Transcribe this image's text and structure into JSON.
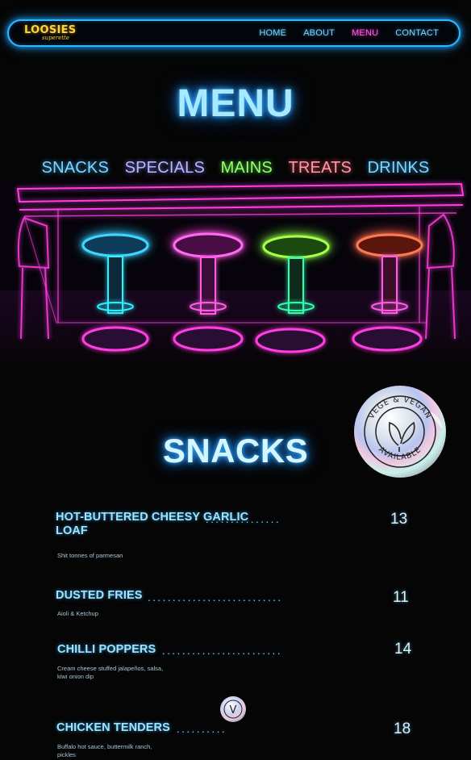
{
  "nav": {
    "logo_main": "LOOSIES",
    "logo_sub": "superette",
    "links": [
      "HOME",
      "ABOUT",
      "MENU",
      "CONTACT"
    ],
    "active": "MENU"
  },
  "hero": {
    "title": "MENU",
    "categories": [
      "SNACKS",
      "SPECIALS",
      "MAINS",
      "TREATS",
      "DRINKS"
    ]
  },
  "section": {
    "title": "SNACKS",
    "badge_top": "VEGE & VEGAN",
    "badge_bottom": "AVAILABLE",
    "mini_badge": "V"
  },
  "items": [
    {
      "name": "HOT-BUTTERED CHEESY GARLIC LOAF",
      "price": "13",
      "desc": "Shit tonnes of parmesan"
    },
    {
      "name": "DUSTED FRIES",
      "price": "11",
      "desc": "Aioli & Ketchup"
    },
    {
      "name": "CHILLI POPPERS",
      "price": "14",
      "desc": "Cream cheese stuffed jalapeños, salsa, kiwi onion dip"
    },
    {
      "name": "CHICKEN TENDERS",
      "price": "18",
      "desc": "Buffalo hot sauce, buttermilk ranch, pickles"
    }
  ],
  "colors": {
    "neon_blue": "#2fb8ff",
    "neon_pink": "#ff3ee0",
    "neon_green": "#7dff3a",
    "neon_red": "#ff5a50",
    "logo_yellow": "#ffd23a"
  }
}
